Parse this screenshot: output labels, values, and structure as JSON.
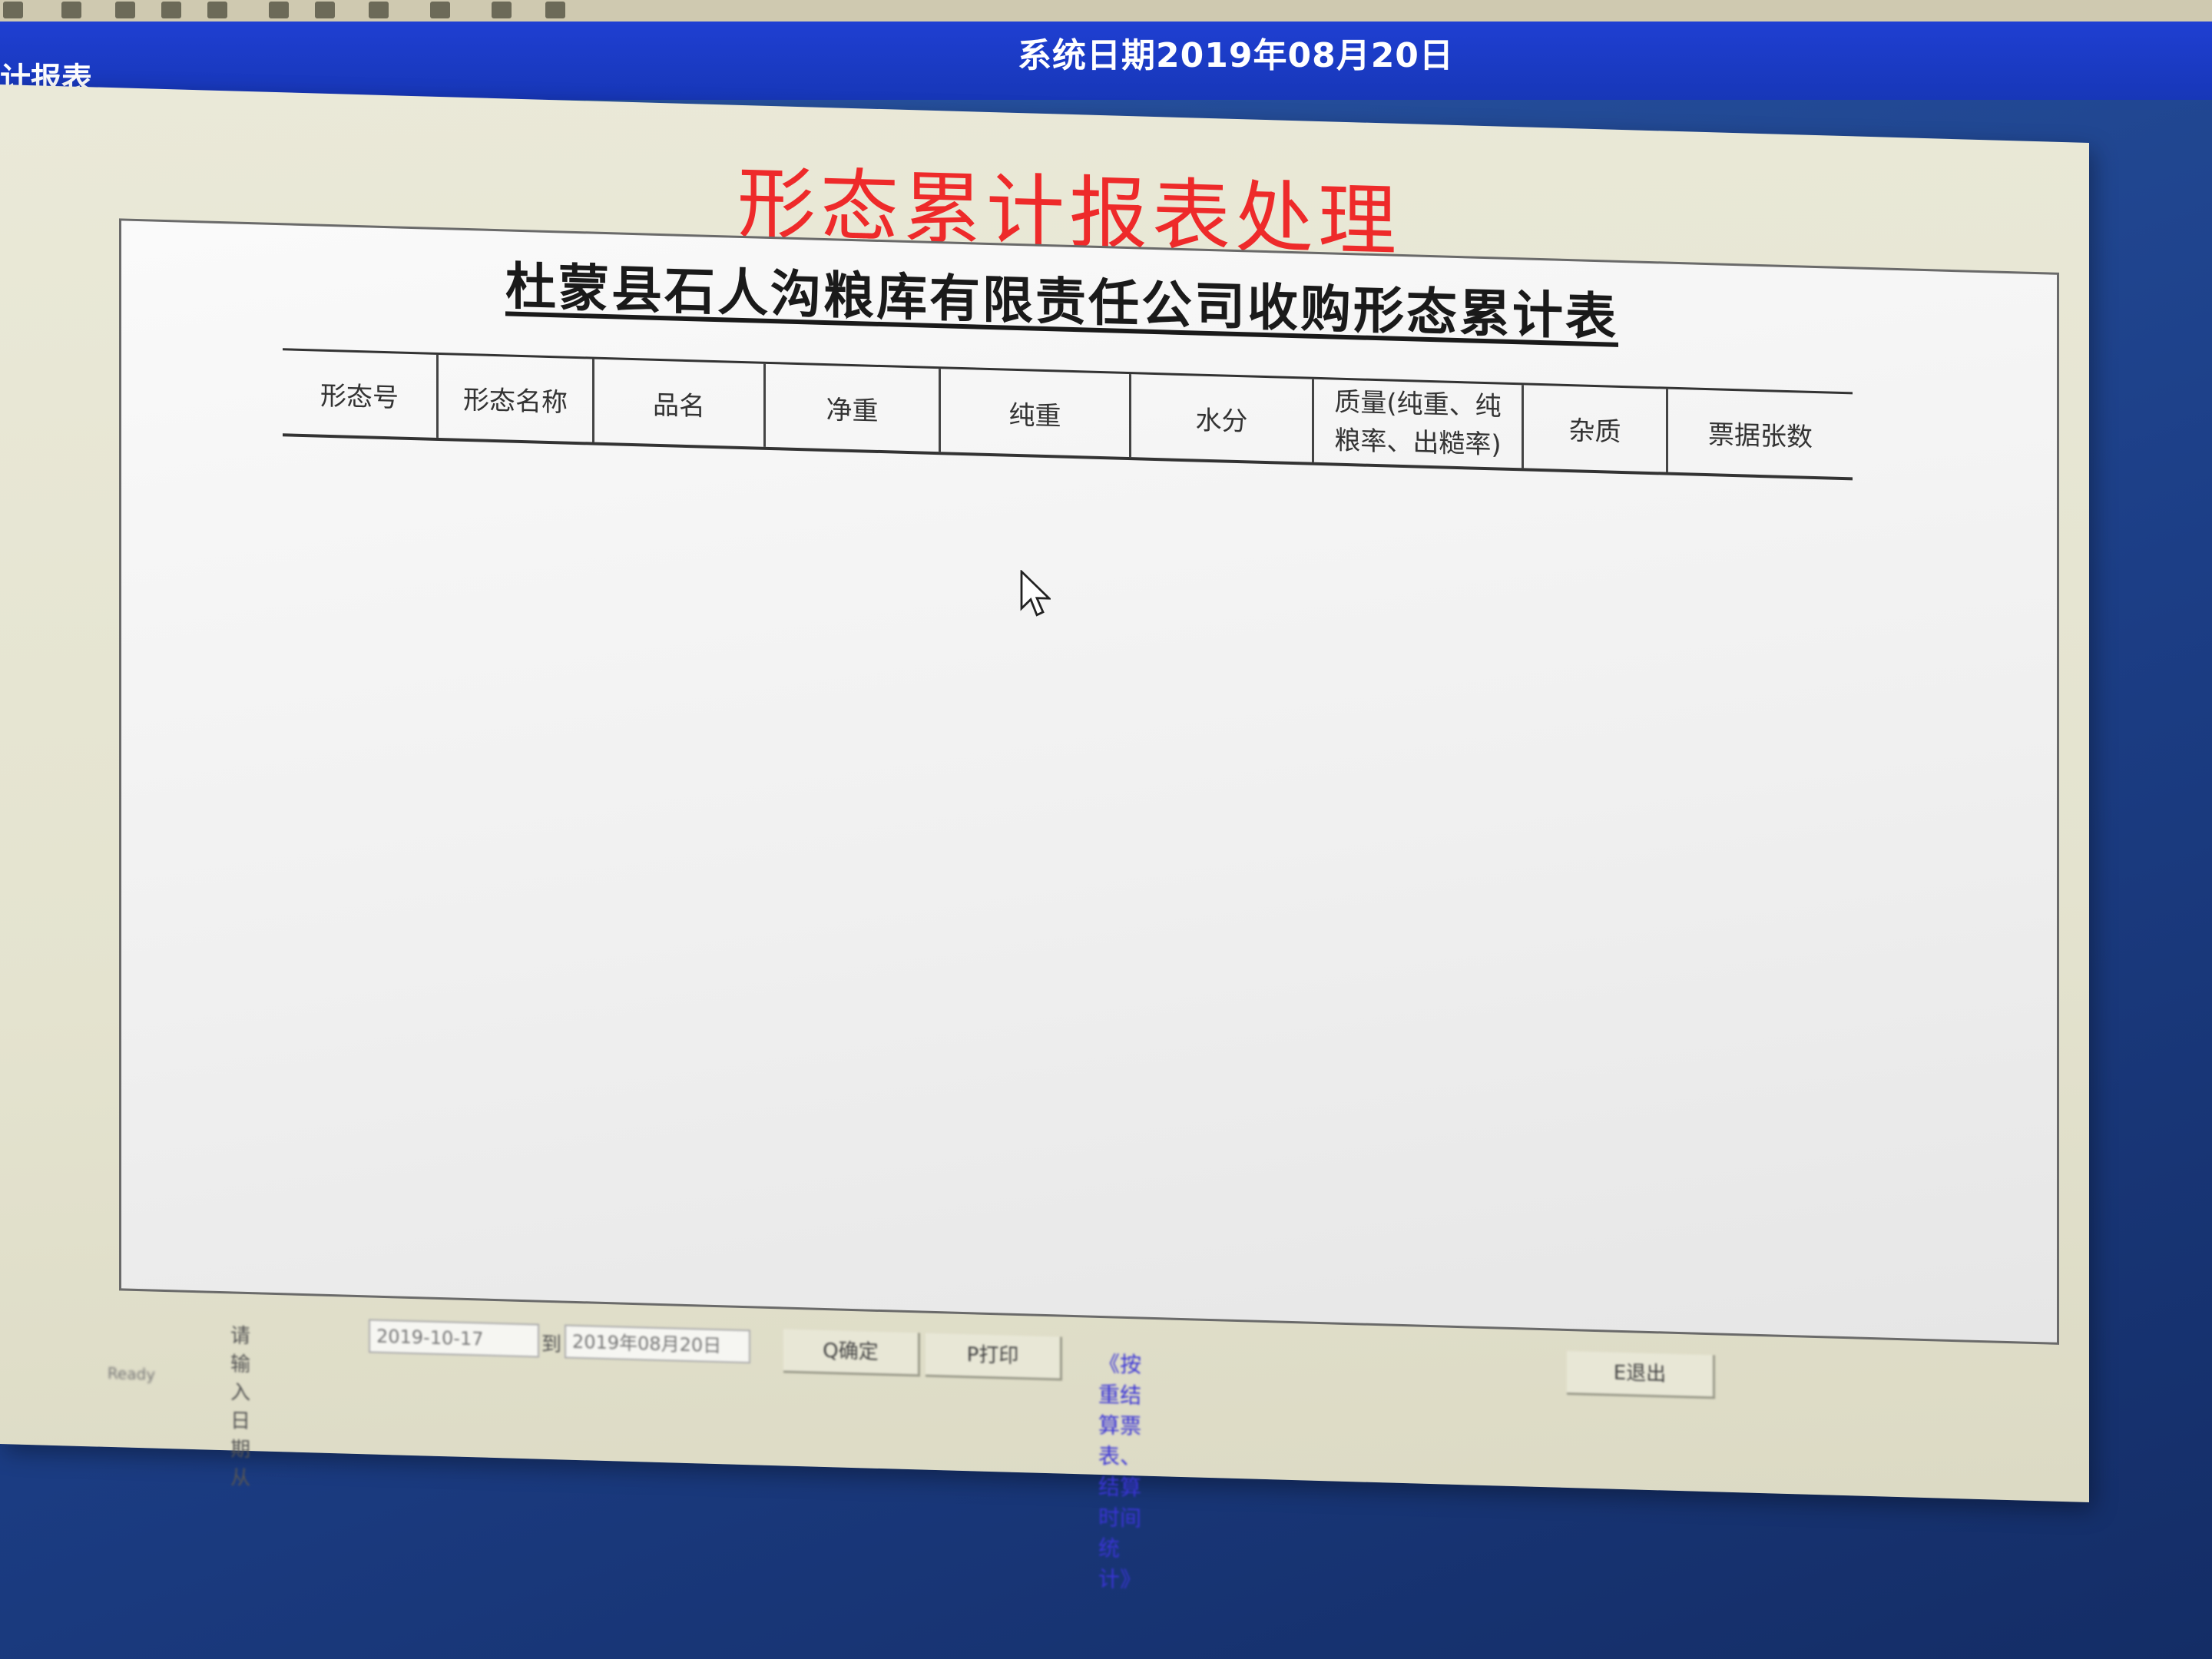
{
  "window": {
    "title": "计报表",
    "system_date": "系统日期2019年08月20日"
  },
  "heading": "形态累计报表处理",
  "report": {
    "title": "杜蒙县石人沟粮库有限责任公司收购形态累计表",
    "columns": [
      "形态号",
      "形态名称",
      "品名",
      "净重",
      "纯重",
      "水分",
      "质量(纯重、纯粮率、出糙率)",
      "杂质",
      "票据张数"
    ]
  },
  "controls": {
    "date_range_label": "请输入日期从",
    "from_date": "2019-10-17",
    "to_label": "到",
    "to_date": "2019年08月20日",
    "confirm_label": "Q确定",
    "print_label": "P打印",
    "hint": "《按重结算票表、结算时间统计》",
    "exit_label": "E退出"
  },
  "status": {
    "text": "Ready"
  },
  "colors": {
    "title_bar": "#1f3fd2",
    "heading": "#ee2a2a",
    "hint": "#3a34d6"
  }
}
